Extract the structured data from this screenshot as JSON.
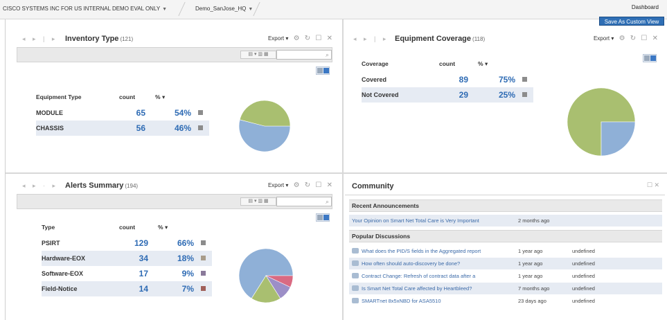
{
  "breadcrumb": {
    "org": "CISCO SYSTEMS INC FOR US INTERNAL DEMO EVAL ONLY",
    "site": "Demo_SanJose_HQ"
  },
  "header": {
    "title": "Dashboard",
    "save_view_label": "Save As Custom View"
  },
  "icons": {
    "nav": "arrow-icons",
    "export_caret": "▾",
    "settings": "⚙",
    "refresh": "↻",
    "maximize": "☐",
    "close": "✕",
    "search": "🔍"
  },
  "colors": {
    "pie_green": "#a9bf70",
    "pie_blue": "#8fb0d7",
    "pie_pink": "#d96a82",
    "pie_brown": "#b07a60",
    "pie_purple": "#9c8fc7",
    "value_blue": "#2e6bb4"
  },
  "inventory": {
    "title": "Inventory Type",
    "count": "(121)",
    "export_label": "Export",
    "columns": [
      "Equipment Type",
      "count",
      "%"
    ],
    "rows": [
      {
        "name": "MODULE",
        "count": "65",
        "pct": "54%"
      },
      {
        "name": "CHASSIS",
        "count": "56",
        "pct": "46%"
      }
    ],
    "pie": [
      54,
      46
    ]
  },
  "coverage": {
    "title": "Equipment Coverage",
    "count": "(118)",
    "export_label": "Export",
    "columns": [
      "Coverage",
      "count",
      "%"
    ],
    "rows": [
      {
        "name": "Covered",
        "count": "89",
        "pct": "75%"
      },
      {
        "name": "Not Covered",
        "count": "29",
        "pct": "25%"
      }
    ],
    "pie": [
      75,
      25
    ]
  },
  "alerts": {
    "title": "Alerts Summary",
    "count": "(194)",
    "export_label": "Export",
    "columns": [
      "Type",
      "count",
      "%"
    ],
    "rows": [
      {
        "name": "PSIRT",
        "count": "129",
        "pct": "66%"
      },
      {
        "name": "Hardware-EOX",
        "count": "34",
        "pct": "18%"
      },
      {
        "name": "Software-EOX",
        "count": "17",
        "pct": "9%"
      },
      {
        "name": "Field-Notice",
        "count": "14",
        "pct": "7%"
      }
    ],
    "pie": [
      66,
      18,
      9,
      7
    ]
  },
  "community": {
    "title": "Community",
    "announcements_label": "Recent Announcements",
    "announcements": [
      {
        "title": "Your Opinion on Smart Net Total Care is Very Important",
        "date": "2 months ago",
        "user": ""
      }
    ],
    "discussions_label": "Popular Discussions",
    "discussions": [
      {
        "title": "What does the PID/S fields in the Aggregated report",
        "date": "1 year ago",
        "user": "undefined"
      },
      {
        "title": "How often should auto-discovery be done?",
        "date": "1 year ago",
        "user": "undefined"
      },
      {
        "title": "Contract Change: Refresh of contract data after a",
        "date": "1 year ago",
        "user": "undefined"
      },
      {
        "title": "Is Smart Net Total Care affected by Heartbleed?",
        "date": "7 months ago",
        "user": "undefined"
      },
      {
        "title": "SMARTnet 8x5xNBD for ASA5510",
        "date": "23 days ago",
        "user": "undefined"
      }
    ]
  }
}
